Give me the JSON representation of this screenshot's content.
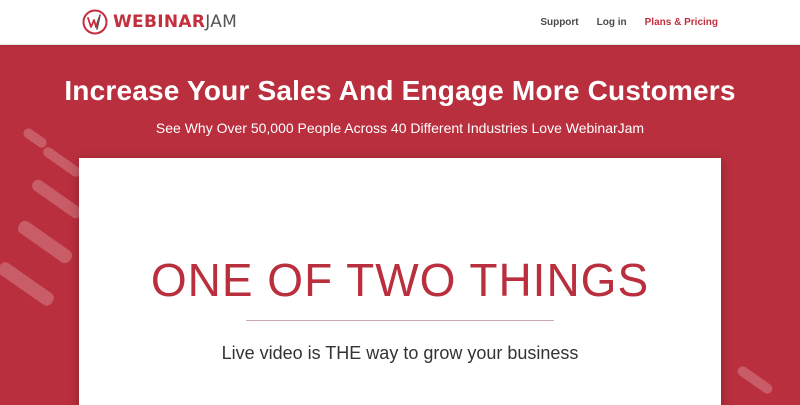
{
  "header": {
    "logo": {
      "brand_bold": "WEBINAR",
      "brand_light": "JAM"
    },
    "nav": [
      {
        "label": "Support"
      },
      {
        "label": "Log in"
      },
      {
        "label": "Plans & Pricing"
      }
    ]
  },
  "hero": {
    "headline": "Increase Your Sales And Engage More Customers",
    "subhead": "See Why Over 50,000 People Across 40 Different Industries Love WebinarJam"
  },
  "video_card": {
    "title": "ONE OF TWO THINGS",
    "subtitle": "Live video is THE way to grow your business"
  },
  "colors": {
    "brand_red": "#b92f3d",
    "accent_link": "#c32f3e",
    "nav_text": "#4a4a4a",
    "card_bg": "#ffffff"
  },
  "icons": [
    "webinarjam-logo-icon"
  ]
}
